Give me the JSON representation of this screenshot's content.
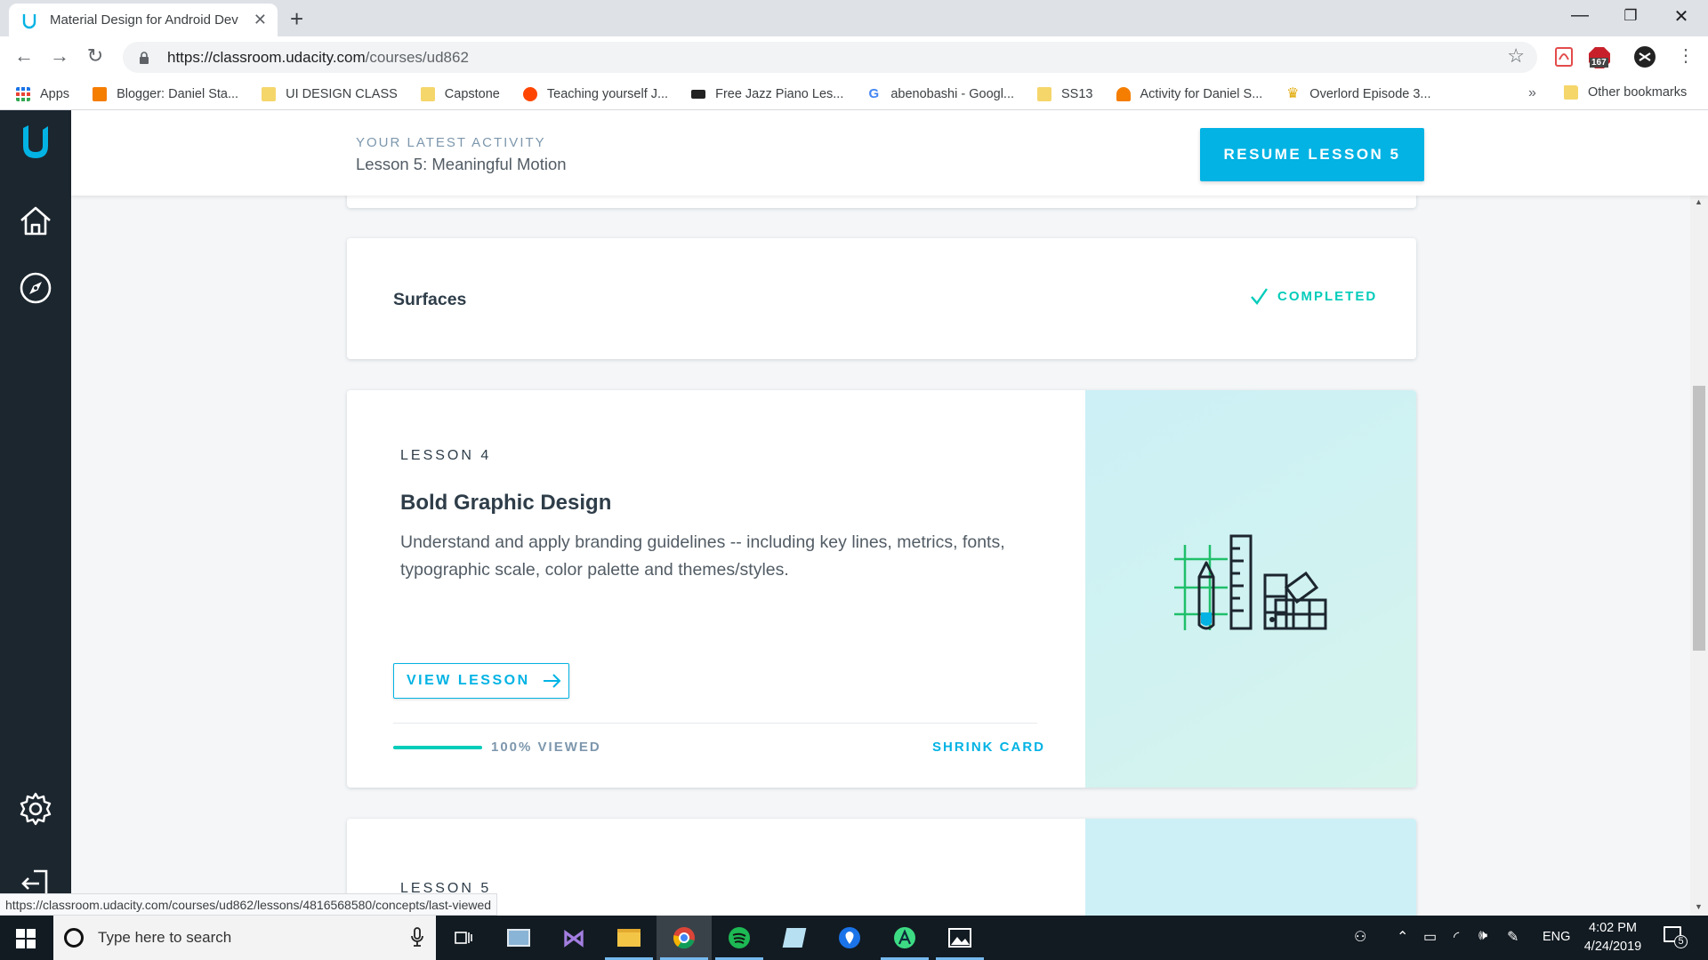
{
  "browser": {
    "tab_title": "Material Design for Android Dev",
    "new_tab": "+",
    "url_host": "https://classroom.udacity.com",
    "url_path": "/courses/ud862",
    "extension_badge": "167",
    "status_url": "https://classroom.udacity.com/courses/ud862/lessons/4816568580/concepts/last-viewed"
  },
  "bookmarks": [
    {
      "label": "Apps",
      "icon": "apps-grid-icon"
    },
    {
      "label": "Blogger: Daniel Sta...",
      "icon": "blogger-icon"
    },
    {
      "label": "UI DESIGN CLASS",
      "icon": "folder-icon"
    },
    {
      "label": "Capstone",
      "icon": "folder-icon"
    },
    {
      "label": "Teaching yourself J...",
      "icon": "reddit-icon"
    },
    {
      "label": "Free Jazz Piano Les...",
      "icon": "piano-icon"
    },
    {
      "label": "abenobashi - Googl...",
      "icon": "google-icon"
    },
    {
      "label": "SS13",
      "icon": "folder-icon"
    },
    {
      "label": "Activity for Daniel S...",
      "icon": "person-icon"
    },
    {
      "label": "Overlord Episode 3...",
      "icon": "crown-icon"
    }
  ],
  "bookmarks_more": "»",
  "bookmarks_other": "Other bookmarks",
  "header": {
    "activity_label": "YOUR LATEST ACTIVITY",
    "activity_lesson": "Lesson 5: Meaningful Motion",
    "resume_label": "RESUME LESSON 5"
  },
  "surfaces": {
    "title": "Surfaces",
    "status": "COMPLETED"
  },
  "lesson4": {
    "label": "LESSON 4",
    "title": "Bold Graphic Design",
    "description": "Understand and apply branding guidelines -- including key lines, metrics, fonts, typographic scale, color palette and themes/styles.",
    "view_label": "VIEW LESSON",
    "progress": 1.0,
    "progress_label": "100% VIEWED",
    "shrink_label": "SHRINK CARD"
  },
  "lesson5": {
    "label": "LESSON 5"
  },
  "taskbar": {
    "search_placeholder": "Type here to search",
    "language": "ENG",
    "time": "4:02 PM",
    "date": "4/24/2019",
    "notification_count": "5"
  },
  "colors": {
    "accent": "#02b3e4",
    "completed": "#02ccba",
    "sidebar": "#1c262f"
  }
}
